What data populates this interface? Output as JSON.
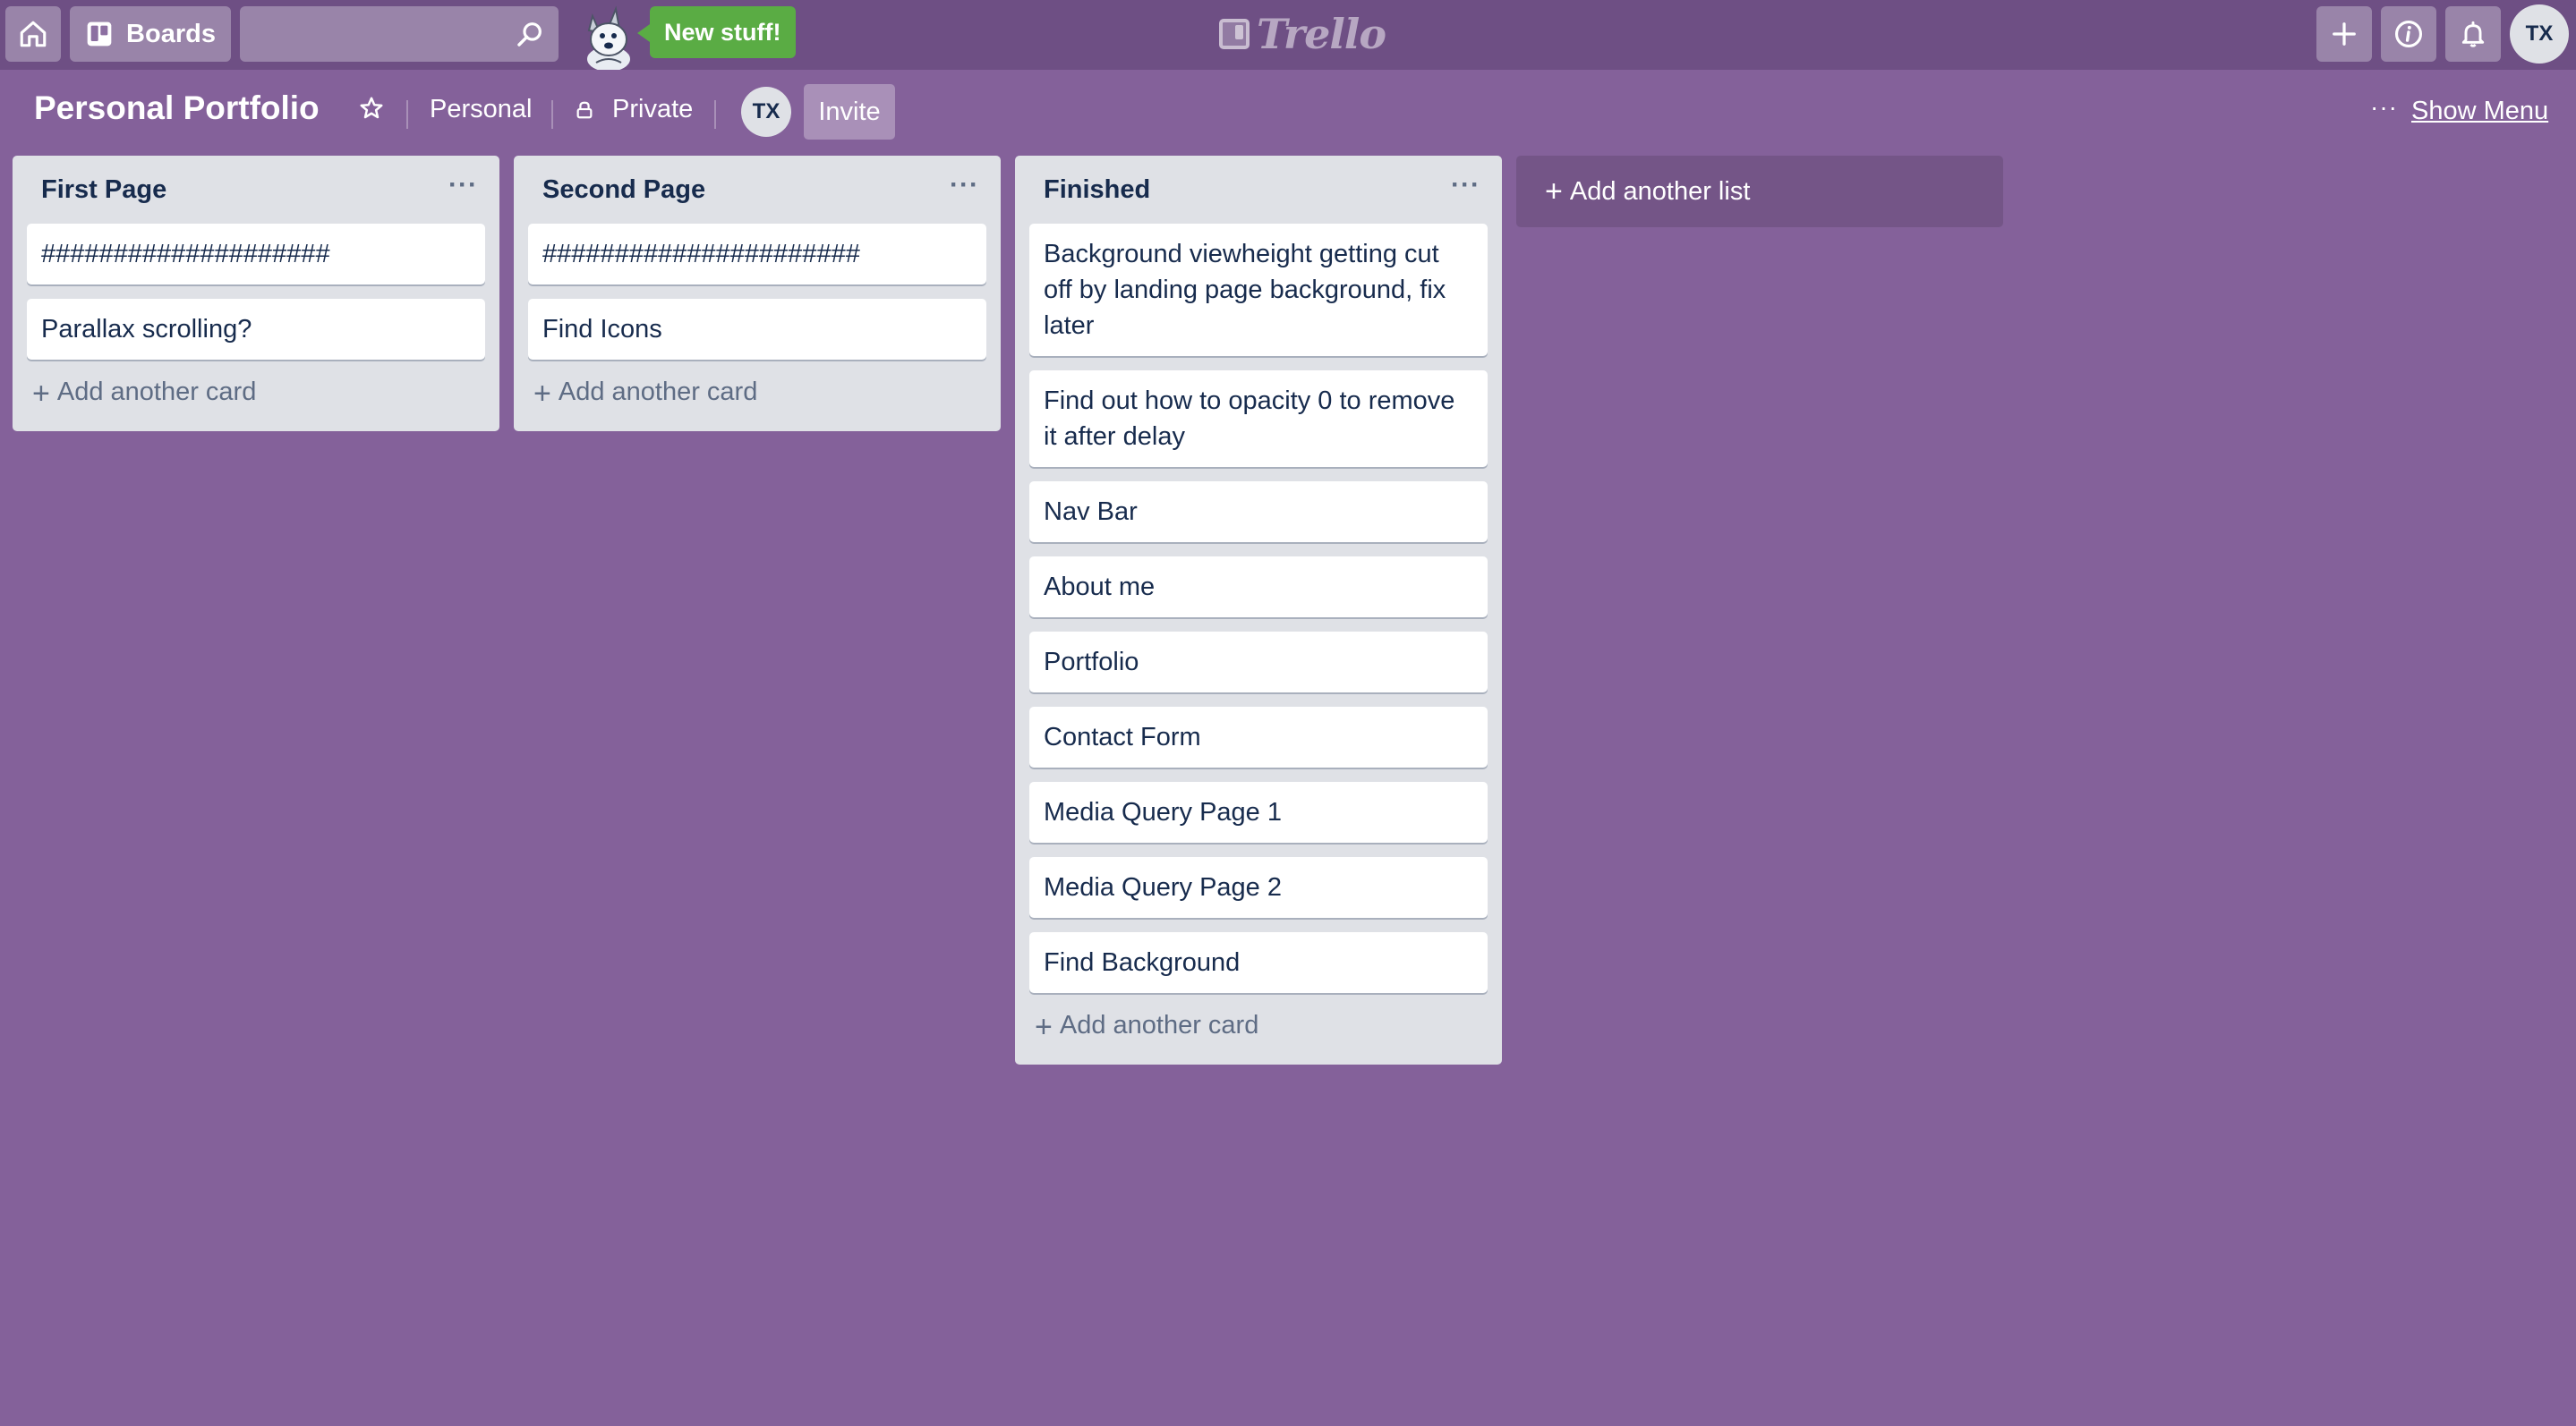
{
  "header": {
    "boards_label": "Boards",
    "search_value": "",
    "new_stuff_label": "New stuff!",
    "logo_text": "Trello",
    "avatar_initials": "TX"
  },
  "board": {
    "title": "Personal Portfolio",
    "team_label": "Personal",
    "visibility_label": "Private",
    "member_initials": "TX",
    "invite_label": "Invite",
    "menu_dots": "···",
    "show_menu_label": "Show Menu"
  },
  "lists": [
    {
      "title": "First Page",
      "menu": "···",
      "cards": [
        "####################",
        "Parallax scrolling?"
      ],
      "add_card_label": "Add another card"
    },
    {
      "title": "Second Page",
      "menu": "···",
      "cards": [
        "######################",
        "Find Icons"
      ],
      "add_card_label": "Add another card"
    },
    {
      "title": "Finished",
      "menu": "···",
      "cards": [
        "Background viewheight getting cut off by landing page background, fix later",
        "Find out how to opacity 0 to remove it after delay",
        "Nav Bar",
        "About me",
        "Portfolio",
        "Contact Form",
        "Media Query Page 1",
        "Media Query Page 2",
        "Find Background"
      ],
      "add_card_label": "Add another card"
    }
  ],
  "add_list_label": "Add another list",
  "colors": {
    "board_background": "#84619a",
    "header_background": "#6e4f84",
    "list_background": "#dfe1e6",
    "new_stuff_green": "#5aac44"
  }
}
